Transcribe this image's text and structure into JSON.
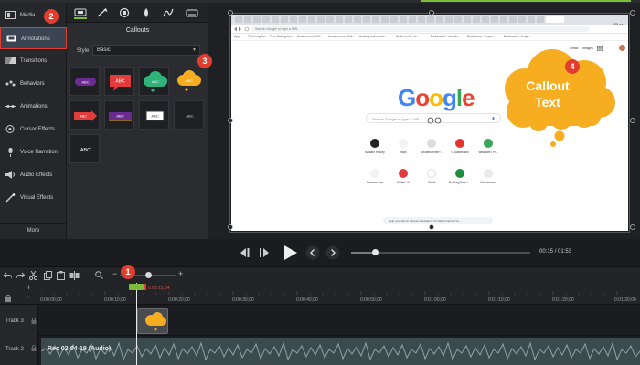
{
  "sidebar": {
    "items": [
      {
        "label": "Media",
        "icon": "media-icon"
      },
      {
        "label": "Annotations",
        "icon": "annotations-icon"
      },
      {
        "label": "Transitions",
        "icon": "transitions-icon"
      },
      {
        "label": "Behaviors",
        "icon": "behaviors-icon"
      },
      {
        "label": "Animations",
        "icon": "animations-icon"
      },
      {
        "label": "Cursor Effects",
        "icon": "cursor-effects-icon"
      },
      {
        "label": "Voice Narration",
        "icon": "microphone-icon"
      },
      {
        "label": "Audio Effects",
        "icon": "speaker-icon"
      },
      {
        "label": "Visual Effects",
        "icon": "wand-icon"
      }
    ],
    "more_label": "More",
    "active": "Annotations"
  },
  "panel": {
    "title": "Callouts",
    "style_label": "Style",
    "style_value": "Basic",
    "tabs": [
      "callouts-tab-icon",
      "arrows-tab-icon",
      "shapes-tab-icon",
      "blur-tab-icon",
      "sketch-motion-tab-icon",
      "keystroke-tab-icon"
    ],
    "thumbs": [
      {
        "label": "ABC",
        "kind": "pill",
        "color": "#6a2c91"
      },
      {
        "label": "ABC",
        "kind": "speech",
        "color": "#e23b3b"
      },
      {
        "label": "ABC",
        "kind": "cloud",
        "color": "#2fb37a"
      },
      {
        "label": "ABC",
        "kind": "cloud",
        "color": "#f6ad1f"
      },
      {
        "label": "ABC",
        "kind": "arrow",
        "color": "#e23b3b"
      },
      {
        "label": "ABC",
        "kind": "ribbon",
        "color": "#6a2c91"
      },
      {
        "label": "ABC",
        "kind": "box",
        "color": "#ffffff"
      },
      {
        "label": "ABC",
        "kind": "text",
        "color": "#dddddd"
      },
      {
        "label": "ABC",
        "kind": "plain",
        "color": "#ffffff"
      }
    ]
  },
  "browser": {
    "address": "Search Google or type a URL",
    "bookmarks": [
      "Apps",
      "The Long Tru...",
      "Time Saving Info...",
      "Amazon.com: Ofi...",
      "Amazon.com: Onli...",
      "Actually and constr...",
      "Settle for the ne...",
      "Dashboard - YouTub...",
      "Dashboard - Vespu...",
      "Dashboard - Vespu..."
    ],
    "top_links": [
      "Gmail",
      "Images"
    ],
    "logo": [
      "G",
      "o",
      "o",
      "g",
      "l",
      "e"
    ],
    "logo_colors": [
      "#4285F4",
      "#EA4335",
      "#FBBC05",
      "#4285F4",
      "#34A853",
      "#EA4335"
    ],
    "search_placeholder": "Search Google or type a URL",
    "shortcuts_row1": [
      "Balsam History",
      "https",
      "Shodel/Drive/P...",
      "G Dashboard",
      "Wikiglam / Pl..."
    ],
    "shortcuts_row2": [
      "Amazon.com",
      "Kinfire 10",
      "Gmail",
      "Booking Free L...",
      "Add shortcut"
    ],
    "footer_text": "Help your tab for Internet Assistance for Safari Internet Go..."
  },
  "callout": {
    "line1": "Callout",
    "line2": "Text",
    "color": "#f6ad1f"
  },
  "markers": [
    "1",
    "2",
    "3",
    "4"
  ],
  "playback": {
    "current_time": "00:15",
    "separator": "/",
    "total_time": "01:53",
    "progress": 0.133
  },
  "timeline": {
    "playhead_time": "0:00:15;04",
    "ticks": [
      "0:00:00;00",
      "0:00:10;00",
      "0:00:20;00",
      "0:00:30;00",
      "0:00:40;00",
      "0:00:50;00",
      "0:01:00;00",
      "0:01:10;00",
      "0:01:20;00",
      "0:01:30;00"
    ],
    "tracks": [
      {
        "label": "Track 3"
      },
      {
        "label": "Track 2",
        "clip": "Rec 02-04-19 (Audio)"
      }
    ],
    "zoom": 0.5
  }
}
